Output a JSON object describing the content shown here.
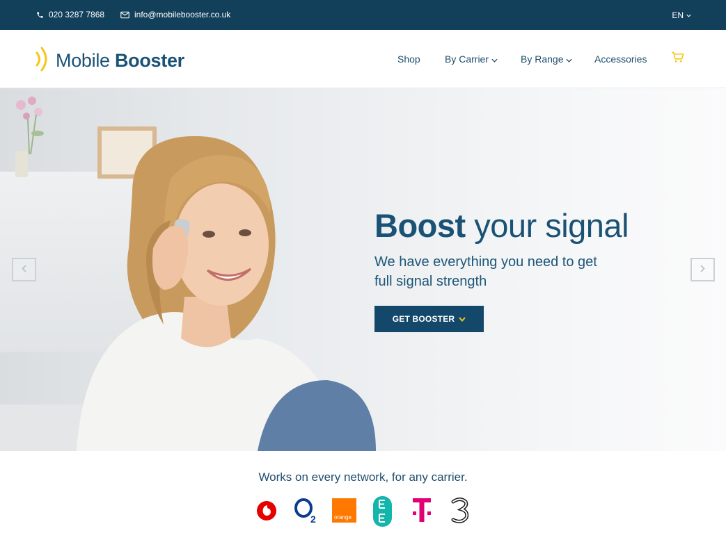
{
  "topbar": {
    "phone": "020 3287 7868",
    "email": "info@mobilebooster.co.uk",
    "language": "EN",
    "icons": [
      "phone-icon",
      "envelope-icon",
      "chevron-down-icon"
    ]
  },
  "header": {
    "logo_text_regular": "Mobile",
    "logo_text_bold": "Booster",
    "nav": {
      "shop": "Shop",
      "by_carrier": "By Carrier",
      "by_range": "By Range",
      "accessories": "Accessories"
    },
    "icons": [
      "signal-waves-icon",
      "cart-icon",
      "chevron-down-icon"
    ]
  },
  "hero": {
    "title_bold": "Boost",
    "title_regular": "your signal",
    "subtitle": "We have everything you need to get full signal strength",
    "button_label": "GET BOOSTER",
    "icons": [
      "chevron-left-icon",
      "chevron-right-icon",
      "chevron-down-icon"
    ]
  },
  "networks": {
    "title": "Works on every network, for any carrier.",
    "logo_orange_label": "orange",
    "carriers": [
      "vodafone-logo",
      "o2-logo",
      "orange-logo",
      "ee-logo",
      "t-mobile-logo",
      "three-logo"
    ]
  },
  "colors": {
    "topbar": "#12405a",
    "brand": "#1a5275",
    "button": "#14486a",
    "accent_yellow": "#f5c518",
    "vodafone": "#e60000",
    "o2": "#0a3d8f",
    "orange": "#ff7900",
    "ee": "#13b5ac",
    "tmobile": "#e20074"
  }
}
